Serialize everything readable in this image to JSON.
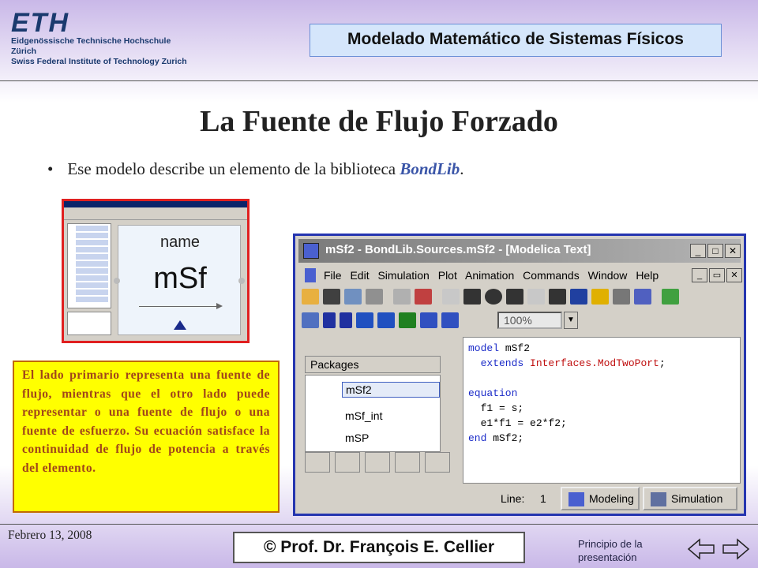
{
  "header": {
    "eth_mark": "ETH",
    "eth_line1": "Eidgenössische Technische Hochschule Zürich",
    "eth_line2": "Swiss Federal Institute of Technology Zurich",
    "course_title": "Modelado Matemático de Sistemas Físicos"
  },
  "slide": {
    "title": "La Fuente de Flujo Forzado",
    "bullet_prefix": "Ese modelo describe un elemento de la biblioteca ",
    "bullet_emphasis": "BondLib",
    "bullet_suffix": "."
  },
  "small_screenshot": {
    "icon_name": "name",
    "icon_label": "mSf"
  },
  "description": "El lado primario representa una fuente de flujo, mientras que el otro lado puede representar o una fuente de flujo o una fuente de esfuerzo. Su ecuación satisface la continuidad de flujo de potencia a través del elemento.",
  "dymola": {
    "window_title": "mSf2 - BondLib.Sources.mSf2 - [Modelica Text]",
    "menu": [
      "File",
      "Edit",
      "Simulation",
      "Plot",
      "Animation",
      "Commands",
      "Window",
      "Help"
    ],
    "zoom": "100%",
    "packages_label": "Packages",
    "packages": [
      "mSf2",
      "mSf_int",
      "mSP"
    ],
    "code": {
      "l1_kw": "model",
      "l1_rest": " mSf2",
      "l2_kw": "  extends",
      "l2_type": " Interfaces.ModTwoPort",
      "l4_kw": "equation",
      "l5": "  f1 = s;",
      "l6": "  e1*f1 = e2*f2;",
      "l7_kw": "end",
      "l7_rest": " mSf2;"
    },
    "line_label": "Line:",
    "line_value": "1",
    "modeling_button": "Modeling",
    "simulation_button": "Simulation",
    "colors": {
      "title_bar": "#7a7a7a",
      "keyword": "#1a2ac8",
      "type": "#c01010"
    }
  },
  "footer": {
    "date": "Febrero 13, 2008",
    "copyright": "© Prof. Dr. François E. Cellier",
    "back_link": "Principio de la presentación"
  }
}
